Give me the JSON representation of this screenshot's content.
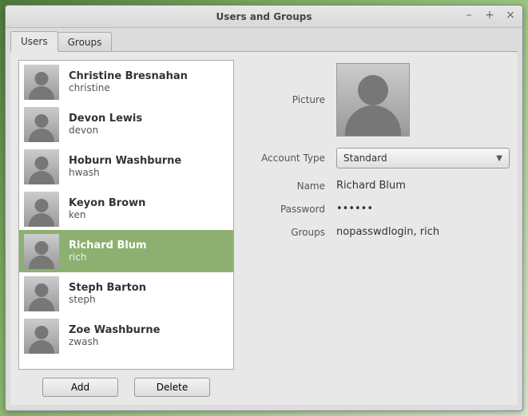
{
  "window": {
    "title": "Users and Groups"
  },
  "tabs": {
    "users": "Users",
    "groups": "Groups",
    "active": "users"
  },
  "users": [
    {
      "fullname": "Christine Bresnahan",
      "login": "christine",
      "selected": false
    },
    {
      "fullname": "Devon Lewis",
      "login": "devon",
      "selected": false
    },
    {
      "fullname": "Hoburn Washburne",
      "login": "hwash",
      "selected": false
    },
    {
      "fullname": "Keyon Brown",
      "login": "ken",
      "selected": false
    },
    {
      "fullname": "Richard Blum",
      "login": "rich",
      "selected": true
    },
    {
      "fullname": "Steph Barton",
      "login": "steph",
      "selected": false
    },
    {
      "fullname": "Zoe Washburne",
      "login": "zwash",
      "selected": false
    }
  ],
  "buttons": {
    "add": "Add",
    "delete": "Delete"
  },
  "labels": {
    "picture": "Picture",
    "accountType": "Account Type",
    "name": "Name",
    "password": "Password",
    "groups": "Groups"
  },
  "detail": {
    "accountType": "Standard",
    "name": "Richard Blum",
    "password": "••••••",
    "groups": "nopasswdlogin, rich"
  }
}
